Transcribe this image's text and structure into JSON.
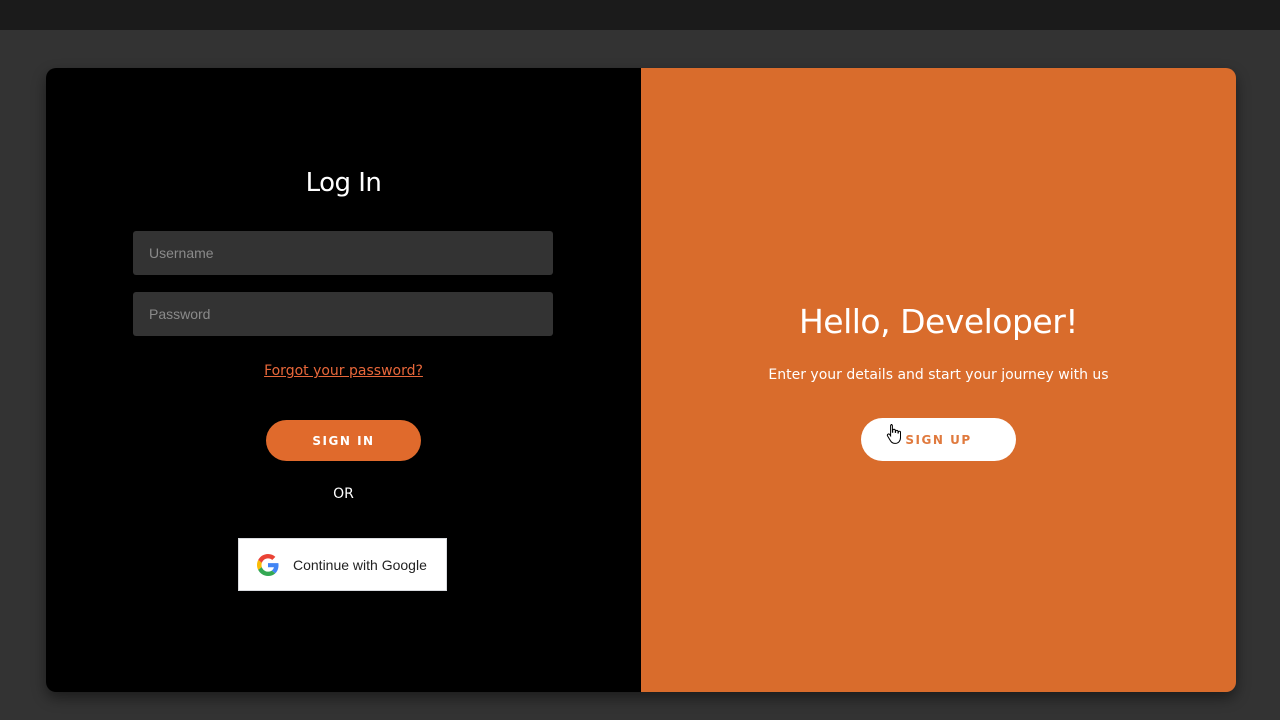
{
  "login": {
    "title": "Log In",
    "username_placeholder": "Username",
    "password_placeholder": "Password",
    "forgot_link": "Forgot your password?",
    "signin_label": "SIGN IN",
    "or_text": "OR",
    "google_label": "Continue with Google",
    "google_icon": "google-g-icon"
  },
  "welcome": {
    "title": "Hello, Developer!",
    "subtitle": "Enter your details and start your journey with us",
    "signup_label": "SIGN UP"
  },
  "colors": {
    "page_background": "#333333",
    "left_panel": "#000000",
    "right_panel": "#d96c2c",
    "accent": "#e06a2c",
    "link": "#e8673a"
  }
}
